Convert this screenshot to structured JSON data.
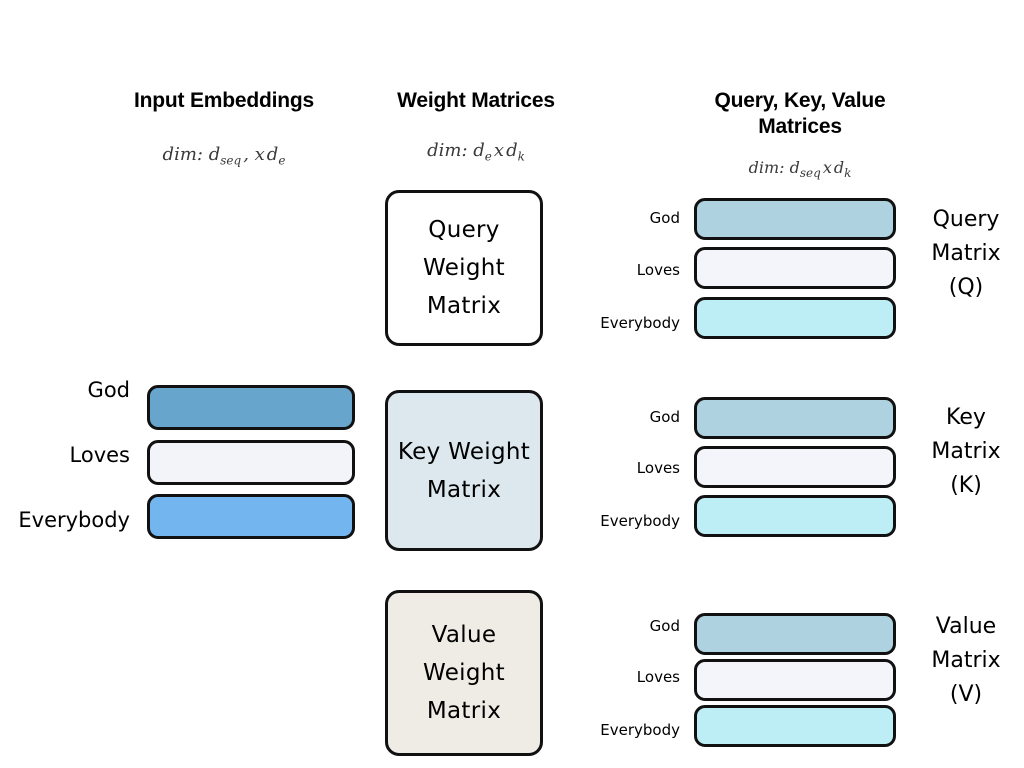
{
  "columns": [
    {
      "id": "input-embeddings",
      "title": "Input Embeddings",
      "dim_prefix": "dim:",
      "dim_a": "d",
      "dim_a_sub": "seq",
      "dim_sep": ", x",
      "dim_b": "d",
      "dim_b_sub": "e"
    },
    {
      "id": "weight-matrices",
      "title": "Weight Matrices",
      "dim_prefix": "dim:",
      "dim_a": "d",
      "dim_a_sub": "e",
      "dim_sep": "x",
      "dim_b": "d",
      "dim_b_sub": "k"
    },
    {
      "id": "qkv-matrices",
      "title": "Query, Key, Value Matrices",
      "dim_prefix": "dim:",
      "dim_a": "d",
      "dim_a_sub": "seq",
      "dim_sep": "x",
      "dim_b": "d",
      "dim_b_sub": "k"
    }
  ],
  "tokens": [
    "God",
    "Loves",
    "Everybody"
  ],
  "input_embeddings": {
    "rows": [
      {
        "label": "God",
        "color": "#68a5cd"
      },
      {
        "label": "Loves",
        "color": "#f2f4fa"
      },
      {
        "label": "Everybody",
        "color": "#73b6ef"
      }
    ]
  },
  "weight_matrices": [
    {
      "id": "query-weight-matrix",
      "lines": [
        "Query",
        "Weight",
        "Matrix"
      ],
      "color": "#ffffff"
    },
    {
      "id": "key-weight-matrix",
      "lines": [
        "Key Weight",
        "Matrix"
      ],
      "color": "#dce7ee"
    },
    {
      "id": "value-weight-matrix",
      "lines": [
        "Value",
        "Weight",
        "Matrix"
      ],
      "color": "#efece5"
    }
  ],
  "output_matrices": [
    {
      "id": "query-matrix",
      "caption_lines": [
        "Query",
        "Matrix",
        "(Q)"
      ],
      "rows": [
        {
          "label": "God",
          "color": "#aed2e0"
        },
        {
          "label": "Loves",
          "color": "#f4f4fb"
        },
        {
          "label": "Everybody",
          "color": "#bdeef5"
        }
      ]
    },
    {
      "id": "key-matrix",
      "caption_lines": [
        "Key",
        "Matrix",
        "(K)"
      ],
      "rows": [
        {
          "label": "God",
          "color": "#aed2e0"
        },
        {
          "label": "Loves",
          "color": "#f4f4fb"
        },
        {
          "label": "Everybody",
          "color": "#bdeef5"
        }
      ]
    },
    {
      "id": "value-matrix",
      "caption_lines": [
        "Value",
        "Matrix",
        "(V)"
      ],
      "rows": [
        {
          "label": "God",
          "color": "#aed2e0"
        },
        {
          "label": "Loves",
          "color": "#f4f4fb"
        },
        {
          "label": "Everybody",
          "color": "#bdeef5"
        }
      ]
    }
  ],
  "theme": {
    "background": "#ffffff",
    "stroke": "#111111",
    "text": "#000000"
  }
}
